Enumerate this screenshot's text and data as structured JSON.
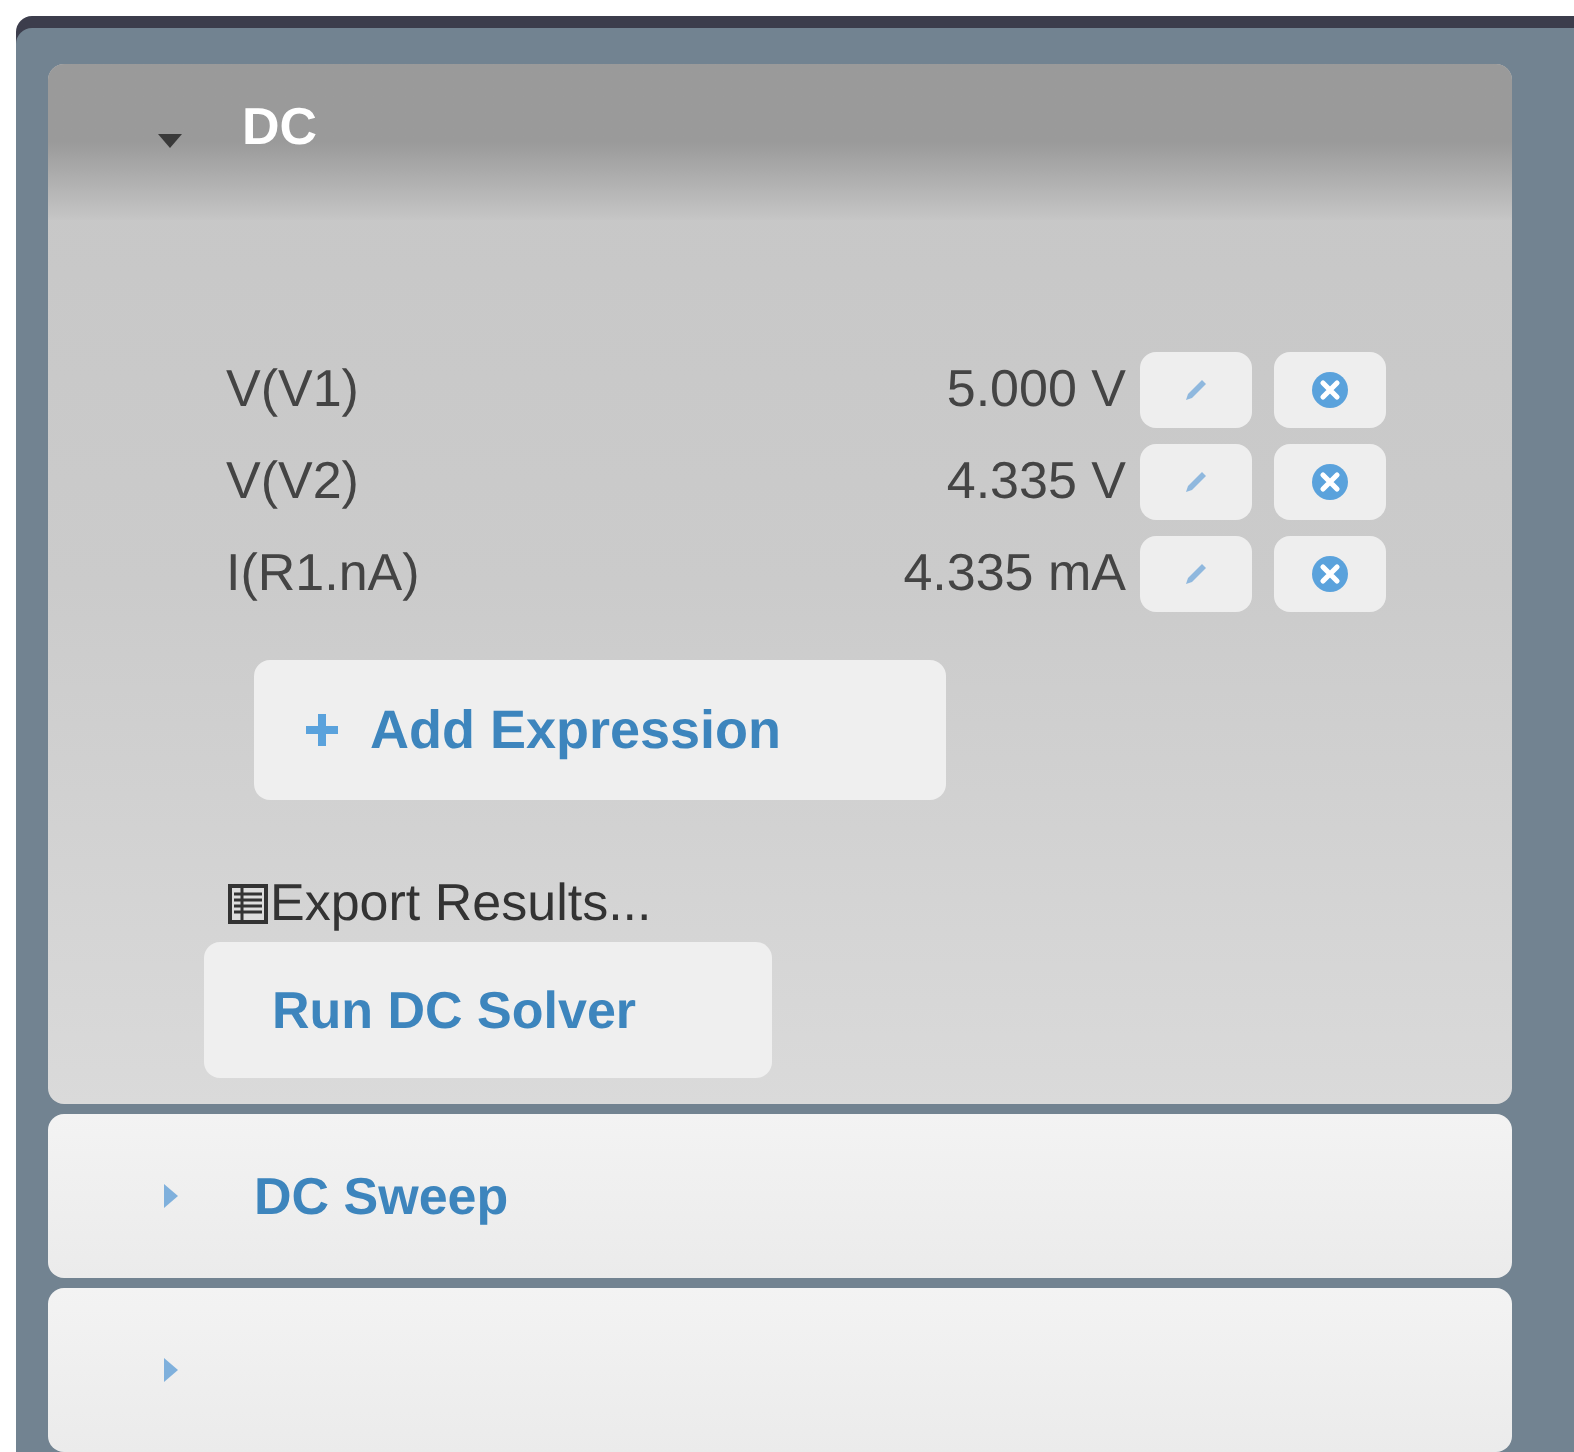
{
  "sections": [
    {
      "title": "DC",
      "expanded": true,
      "expressions": [
        {
          "label": "V(V1)",
          "value": "5.000 V"
        },
        {
          "label": "V(V2)",
          "value": "4.335 V"
        },
        {
          "label": "I(R1.nA)",
          "value": "4.335 mA"
        }
      ],
      "add_button": "Add Expression",
      "export_link": "Export Results...",
      "run_button": "Run DC Solver"
    },
    {
      "title": "DC Sweep",
      "expanded": false
    },
    {
      "expanded": false
    }
  ]
}
